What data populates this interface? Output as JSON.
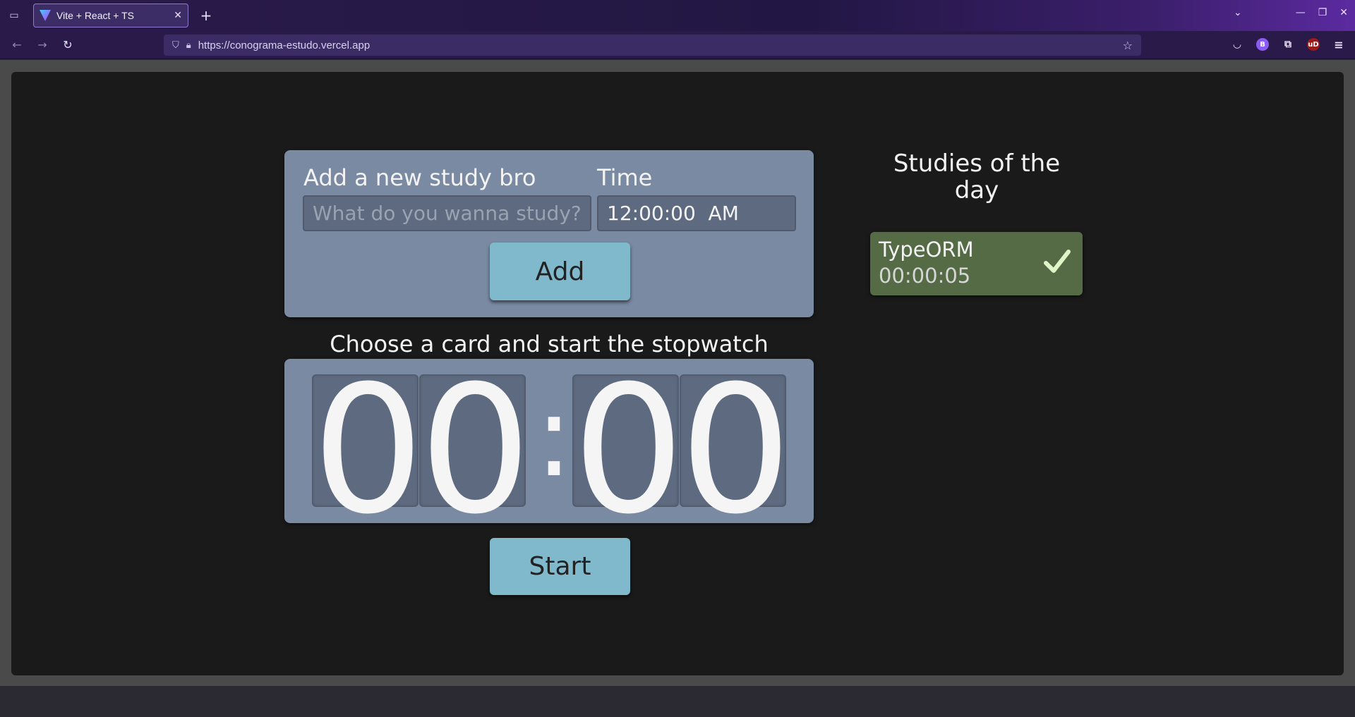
{
  "browser": {
    "tab_title": "Vite + React + TS",
    "url": "https://conograma-estudo.vercel.app"
  },
  "form": {
    "study_label": "Add a new study bro",
    "study_placeholder": "What do you wanna study?",
    "time_label": "Time",
    "time_value": "12:00:00  AM",
    "add_label": "Add"
  },
  "stopwatch": {
    "prompt": "Choose a card and start the stopwatch",
    "digits": [
      "0",
      "0",
      "0",
      "0"
    ],
    "separator": ":",
    "start_label": "Start"
  },
  "studies": {
    "title": "Studies of the day",
    "items": [
      {
        "name": "TypeORM",
        "time": "00:00:05",
        "done": true
      }
    ]
  },
  "colors": {
    "panel": "#7a8aa3",
    "button": "#80b8cc",
    "card_done": "#556b46",
    "check": "#dff5c8"
  }
}
